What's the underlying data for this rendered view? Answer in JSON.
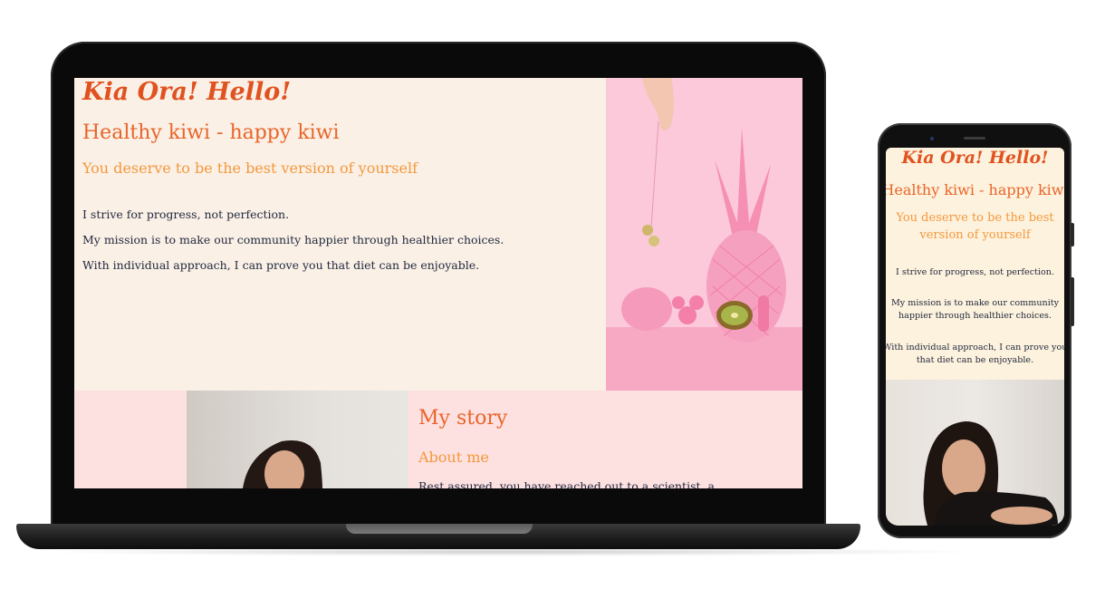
{
  "laptop": {
    "hero": {
      "greeting": "Kia Ora! Hello!",
      "heading": "Healthy kiwi - happy kiwi",
      "subheading": "You deserve to be the best version of yourself",
      "paragraphs": [
        "I strive for progress, not perfection.",
        "My mission is to make our community happier through healthier choices.",
        "With individual approach, I can prove you that diet can be enjoyable."
      ]
    },
    "story": {
      "heading": "My story",
      "subheading": "About me",
      "intro": "Rest assured, you have reached out to a scientist, a"
    }
  },
  "phone": {
    "greeting": "Kia Ora! Hello!",
    "heading": "Healthy kiwi - happy kiwi",
    "subheading": "You deserve to be the best version of yourself",
    "paragraphs": [
      "I strive for progress, not perfection.",
      "My mission is to make our community happier through healthier choices.",
      "With individual approach, I can prove you that diet can be enjoyable."
    ]
  },
  "colors": {
    "title": "#e0521f",
    "heading": "#e8652a",
    "subheading": "#f5983e",
    "body_text": "#222a3f",
    "hero_bg": "#faf0e6",
    "story_bg": "#fde0e0",
    "photo_pink": "#fbc8d8"
  }
}
